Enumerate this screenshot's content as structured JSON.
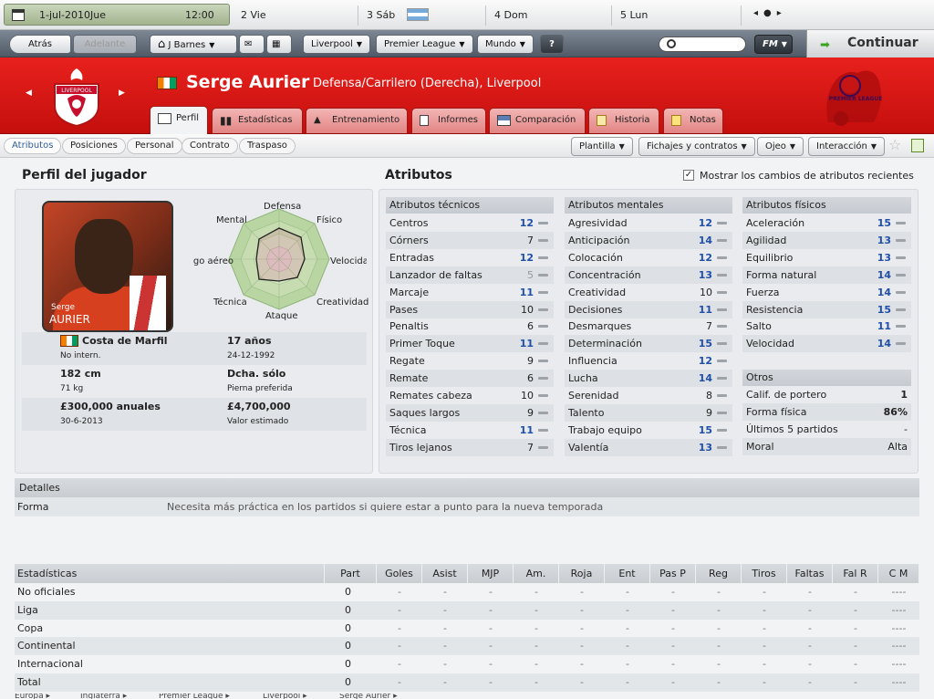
{
  "calendar": {
    "current_date": "1-jul-2010",
    "current_day": "Jue",
    "time": "12:00",
    "days": [
      "2 Vie",
      "3 Sáb",
      "4 Dom",
      "5 Lun"
    ]
  },
  "toolbar": {
    "back": "Atrás",
    "forward": "Adelante",
    "manager": "J Barnes",
    "club": "Liverpool",
    "league": "Premier League",
    "world": "Mundo",
    "help": "?",
    "fm_menu": "FM",
    "search_placeholder": "",
    "continue": "Continuar"
  },
  "header": {
    "player_name": "Serge Aurier",
    "position_club": "Defensa/Carrilero (Derecha), Liverpool",
    "crest_text": "LIVERPOOL",
    "league_logo_text": "PREMIER LEAGUE",
    "tabs": [
      "Perfil",
      "Estadísticas",
      "Entrenamiento",
      "Informes",
      "Comparación",
      "Historia",
      "Notas"
    ]
  },
  "subnav": {
    "tabs": [
      "Atributos",
      "Posiciones",
      "Personal",
      "Contrato",
      "Traspaso"
    ],
    "menus": [
      "Plantilla",
      "Fichajes y contratos",
      "Ojeo",
      "Interacción"
    ]
  },
  "profile": {
    "title": "Perfil del jugador",
    "photo_name_small": "Serge",
    "photo_name": "AURIER",
    "radar_labels": {
      "top": "Defensa",
      "top_right": "Físico",
      "right": "Velocidad",
      "bottom_right": "Creatividad",
      "bottom": "Ataque",
      "bottom_left": "Técnica",
      "left": "Juego aéreo",
      "top_left": "Mental"
    },
    "nationality": "Costa de Marfil",
    "international": "No intern.",
    "age": "17 años",
    "birth_date": "24-12-1992",
    "height": "182 cm",
    "weight": "71 kg",
    "foot": "Dcha. sólo",
    "foot_label": "Pierna preferida",
    "wage": "£300,000 anuales",
    "contract_end": "30-6-2013",
    "value": "£4,700,000",
    "value_label": "Valor estimado"
  },
  "attributes": {
    "title": "Atributos",
    "show_changes_label": "Mostrar los cambios de atributos recientes",
    "technical": {
      "title": "Atributos técnicos",
      "items": [
        {
          "name": "Centros",
          "value": "12"
        },
        {
          "name": "Córners",
          "value": "7"
        },
        {
          "name": "Entradas",
          "value": "12"
        },
        {
          "name": "Lanzador de faltas",
          "value": "5"
        },
        {
          "name": "Marcaje",
          "value": "11"
        },
        {
          "name": "Pases",
          "value": "10"
        },
        {
          "name": "Penaltis",
          "value": "6"
        },
        {
          "name": "Primer Toque",
          "value": "11"
        },
        {
          "name": "Regate",
          "value": "9"
        },
        {
          "name": "Remate",
          "value": "6"
        },
        {
          "name": "Remates cabeza",
          "value": "10"
        },
        {
          "name": "Saques largos",
          "value": "9"
        },
        {
          "name": "Técnica",
          "value": "11"
        },
        {
          "name": "Tiros lejanos",
          "value": "7"
        }
      ]
    },
    "mental": {
      "title": "Atributos mentales",
      "items": [
        {
          "name": "Agresividad",
          "value": "12"
        },
        {
          "name": "Anticipación",
          "value": "14"
        },
        {
          "name": "Colocación",
          "value": "12"
        },
        {
          "name": "Concentración",
          "value": "13"
        },
        {
          "name": "Creatividad",
          "value": "10"
        },
        {
          "name": "Decisiones",
          "value": "11"
        },
        {
          "name": "Desmarques",
          "value": "7"
        },
        {
          "name": "Determinación",
          "value": "15"
        },
        {
          "name": "Influencia",
          "value": "12"
        },
        {
          "name": "Lucha",
          "value": "14"
        },
        {
          "name": "Serenidad",
          "value": "8"
        },
        {
          "name": "Talento",
          "value": "9"
        },
        {
          "name": "Trabajo equipo",
          "value": "15"
        },
        {
          "name": "Valentía",
          "value": "13"
        }
      ]
    },
    "physical": {
      "title": "Atributos físicos",
      "items": [
        {
          "name": "Aceleración",
          "value": "15"
        },
        {
          "name": "Agilidad",
          "value": "13"
        },
        {
          "name": "Equilibrio",
          "value": "13"
        },
        {
          "name": "Forma natural",
          "value": "14"
        },
        {
          "name": "Fuerza",
          "value": "14"
        },
        {
          "name": "Resistencia",
          "value": "15"
        },
        {
          "name": "Salto",
          "value": "11"
        },
        {
          "name": "Velocidad",
          "value": "14"
        }
      ]
    },
    "others": {
      "title": "Otros",
      "items": [
        {
          "name": "Calif. de portero",
          "value": "1"
        },
        {
          "name": "Forma física",
          "value": "86%"
        },
        {
          "name": "Últimos 5 partidos",
          "value": "-"
        },
        {
          "name": "Moral",
          "value": "Alta"
        }
      ]
    }
  },
  "details": {
    "title": "Detalles",
    "label": "Forma",
    "text": "Necesita más práctica en los partidos si quiere estar a punto para la nueva temporada"
  },
  "stats": {
    "columns": [
      "Estadísticas",
      "Part",
      "Goles",
      "Asist",
      "MJP",
      "Am.",
      "Roja",
      "Ent",
      "Pas P",
      "Reg",
      "Tiros",
      "Faltas",
      "Fal R",
      "C M"
    ],
    "rows": [
      {
        "name": "No oficiales",
        "part": "0",
        "dash": "-",
        "cm": "----"
      },
      {
        "name": "Liga",
        "part": "0",
        "dash": "-",
        "cm": "----"
      },
      {
        "name": "Copa",
        "part": "0",
        "dash": "-",
        "cm": "----"
      },
      {
        "name": "Continental",
        "part": "0",
        "dash": "-",
        "cm": "----"
      },
      {
        "name": "Internacional",
        "part": "0",
        "dash": "-",
        "cm": "----"
      },
      {
        "name": "Total",
        "part": "0",
        "dash": "-",
        "cm": "----"
      }
    ]
  },
  "breadcrumbs": [
    "Europa",
    "Inglaterra",
    "Premier League",
    "Liverpool",
    "Serge Aurier"
  ],
  "colors": {
    "header_red": "#d8191a",
    "value_blue": "#1f4fa8",
    "calendar_green": "#a3b48f"
  }
}
